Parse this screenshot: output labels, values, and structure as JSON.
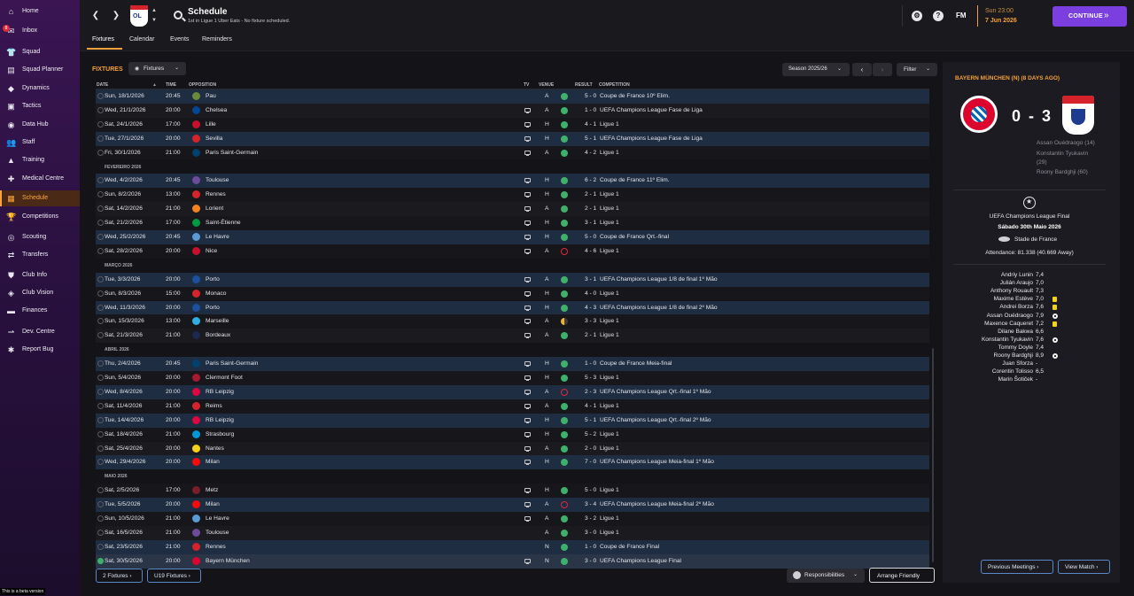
{
  "sidebar": {
    "items": [
      {
        "label": "Home",
        "icon": "home-icon",
        "glyph": "⌂"
      },
      {
        "label": "Inbox",
        "icon": "inbox-icon",
        "glyph": "✉",
        "badge": "8"
      },
      {
        "label": "Squad",
        "icon": "squad-icon",
        "glyph": "👕"
      },
      {
        "label": "Squad Planner",
        "icon": "planner-icon",
        "glyph": "▤"
      },
      {
        "label": "Dynamics",
        "icon": "dynamics-icon",
        "glyph": "◆"
      },
      {
        "label": "Tactics",
        "icon": "tactics-icon",
        "glyph": "▣"
      },
      {
        "label": "Data Hub",
        "icon": "data-hub-icon",
        "glyph": "◉"
      },
      {
        "label": "Staff",
        "icon": "staff-icon",
        "glyph": "👥"
      },
      {
        "label": "Training",
        "icon": "training-icon",
        "glyph": "▲"
      },
      {
        "label": "Medical Centre",
        "icon": "medical-icon",
        "glyph": "✚"
      },
      {
        "label": "Schedule",
        "icon": "schedule-icon",
        "glyph": "▦",
        "active": true
      },
      {
        "label": "Competitions",
        "icon": "trophy-icon",
        "glyph": "🏆"
      },
      {
        "label": "Scouting",
        "icon": "scouting-icon",
        "glyph": "◎"
      },
      {
        "label": "Transfers",
        "icon": "transfers-icon",
        "glyph": "⇄"
      },
      {
        "label": "Club Info",
        "icon": "club-info-icon",
        "glyph": "⛊"
      },
      {
        "label": "Club Vision",
        "icon": "club-vision-icon",
        "glyph": "◈"
      },
      {
        "label": "Finances",
        "icon": "finances-icon",
        "glyph": "▬"
      },
      {
        "label": "Dev. Centre",
        "icon": "dev-centre-icon",
        "glyph": "⇀"
      },
      {
        "label": "Report Bug",
        "icon": "bug-icon",
        "glyph": "✱"
      }
    ],
    "beta_text": "This is a beta version"
  },
  "topbar": {
    "title": "Schedule",
    "subtitle": "1st in Ligue 1 Uber Eats - No fixture scheduled.",
    "club_abbr": "OL",
    "date_time": "Sun 23:00",
    "date_day": "7 Jun 2026",
    "fm_label": "FM",
    "continue_label": "CONTINUE",
    "continue_icon": "»"
  },
  "tabs": [
    "Fixtures",
    "Calendar",
    "Events",
    "Reminders"
  ],
  "fixtures_panel": {
    "heading": "FIXTURES",
    "view_dropdown": "Fixtures",
    "season": "Season 2025/26",
    "filter": "Filter",
    "columns": {
      "date": "DATE",
      "time": "TIME",
      "opposition": "OPPOSITION",
      "tv": "TV",
      "venue": "VENUE",
      "result": "RESULT",
      "competition": "COMPETITION"
    },
    "footer_btn1": "2 Fixtures ›",
    "footer_btn2": "U19 Fixtures ›",
    "responsibilities": "Responsibilities",
    "arrange_friendly": "Arrange Friendly"
  },
  "fixtures": [
    {
      "date": "Sun, 18/1/2026",
      "time": "20:45",
      "opp": "Pau",
      "tv": false,
      "venue": "A",
      "res": "W",
      "score": "5 - 0",
      "comp": "Coupe de France 10º Elim.",
      "crest": "#6b8b3a",
      "bg": "blue"
    },
    {
      "date": "Wed, 21/1/2026",
      "time": "20:00",
      "opp": "Chelsea",
      "tv": true,
      "venue": "A",
      "res": "W",
      "score": "1 - 0",
      "comp": "UEFA Champions League Fase de Liga",
      "crest": "#034694",
      "bg": "dark"
    },
    {
      "date": "Sat, 24/1/2026",
      "time": "17:00",
      "opp": "Lille",
      "tv": true,
      "venue": "H",
      "res": "W",
      "score": "4 - 1",
      "comp": "Ligue 1",
      "crest": "#c8102e",
      "bg": "alt"
    },
    {
      "date": "Tue, 27/1/2026",
      "time": "20:00",
      "opp": "Sevilla",
      "tv": true,
      "venue": "H",
      "res": "W",
      "score": "5 - 1",
      "comp": "UEFA Champions League Fase de Liga",
      "crest": "#d6232b",
      "bg": "blue"
    },
    {
      "date": "Fri, 30/1/2026",
      "time": "21:00",
      "opp": "Paris Saint-Germain",
      "tv": true,
      "venue": "A",
      "res": "W",
      "score": "4 - 2",
      "comp": "Ligue 1",
      "crest": "#004170",
      "bg": "alt"
    },
    {
      "month": "FEVEREIRO 2026"
    },
    {
      "date": "Wed, 4/2/2026",
      "time": "20:45",
      "opp": "Toulouse",
      "tv": true,
      "venue": "H",
      "res": "W",
      "score": "6 - 2",
      "comp": "Coupe de France 11º Elim.",
      "crest": "#6c4a9c",
      "bg": "blue"
    },
    {
      "date": "Sun, 8/2/2026",
      "time": "13:00",
      "opp": "Rennes",
      "tv": true,
      "venue": "H",
      "res": "W",
      "score": "2 - 1",
      "comp": "Ligue 1",
      "crest": "#d6232b",
      "bg": "alt"
    },
    {
      "date": "Sat, 14/2/2026",
      "time": "21:00",
      "opp": "Lorient",
      "tv": true,
      "venue": "A",
      "res": "W",
      "score": "2 - 1",
      "comp": "Ligue 1",
      "crest": "#f58220",
      "bg": "dark"
    },
    {
      "date": "Sat, 21/2/2026",
      "time": "17:00",
      "opp": "Saint-Étienne",
      "tv": true,
      "venue": "H",
      "res": "W",
      "score": "3 - 1",
      "comp": "Ligue 1",
      "crest": "#009a44",
      "bg": "alt"
    },
    {
      "date": "Wed, 25/2/2026",
      "time": "20:45",
      "opp": "Le Havre",
      "tv": true,
      "venue": "H",
      "res": "W",
      "score": "5 - 0",
      "comp": "Coupe de France Qrt.-final",
      "crest": "#5b9bd5",
      "bg": "blue"
    },
    {
      "date": "Sat, 28/2/2026",
      "time": "20:00",
      "opp": "Nice",
      "tv": true,
      "venue": "A",
      "res": "L",
      "score": "4 - 6",
      "comp": "Ligue 1",
      "crest": "#c8102e",
      "bg": "alt"
    },
    {
      "month": "MARÇO 2026"
    },
    {
      "date": "Tue, 3/3/2026",
      "time": "20:00",
      "opp": "Porto",
      "tv": true,
      "venue": "A",
      "res": "W",
      "score": "3 - 1",
      "comp": "UEFA Champions League 1/8 de final 1º Mão",
      "crest": "#1c4f9c",
      "bg": "blue"
    },
    {
      "date": "Sun, 8/3/2026",
      "time": "15:00",
      "opp": "Monaco",
      "tv": true,
      "venue": "H",
      "res": "W",
      "score": "4 - 0",
      "comp": "Ligue 1",
      "crest": "#d6232b",
      "bg": "alt"
    },
    {
      "date": "Wed, 11/3/2026",
      "time": "20:00",
      "opp": "Porto",
      "tv": true,
      "venue": "H",
      "res": "W",
      "score": "4 - 3",
      "comp": "UEFA Champions League 1/8 de final 2º Mão",
      "crest": "#1c4f9c",
      "bg": "blue"
    },
    {
      "date": "Sun, 15/3/2026",
      "time": "13:00",
      "opp": "Marseille",
      "tv": true,
      "venue": "A",
      "res": "D",
      "score": "3 - 3",
      "comp": "Ligue 1",
      "crest": "#2faee0",
      "bg": "alt"
    },
    {
      "date": "Sat, 21/3/2026",
      "time": "21:00",
      "opp": "Bordeaux",
      "tv": true,
      "venue": "A",
      "res": "W",
      "score": "2 - 1",
      "comp": "Ligue 1",
      "crest": "#1b2a4e",
      "bg": "dark"
    },
    {
      "month": "ABRIL 2026"
    },
    {
      "date": "Thu, 2/4/2026",
      "time": "20:45",
      "opp": "Paris Saint-Germain",
      "tv": true,
      "venue": "H",
      "res": "W",
      "score": "1 - 0",
      "comp": "Coupe de France Meia-final",
      "crest": "#004170",
      "bg": "blue"
    },
    {
      "date": "Sun, 5/4/2026",
      "time": "20:00",
      "opp": "Clermont Foot",
      "tv": true,
      "venue": "H",
      "res": "W",
      "score": "5 - 3",
      "comp": "Ligue 1",
      "crest": "#a6192e",
      "bg": "alt"
    },
    {
      "date": "Wed, 8/4/2026",
      "time": "20:00",
      "opp": "RB Leipzig",
      "tv": true,
      "venue": "A",
      "res": "L",
      "score": "2 - 3",
      "comp": "UEFA Champions League Qrt.-final 1º Mão",
      "crest": "#dd0741",
      "bg": "blue"
    },
    {
      "date": "Sat, 11/4/2026",
      "time": "21:00",
      "opp": "Reims",
      "tv": true,
      "venue": "A",
      "res": "W",
      "score": "4 - 1",
      "comp": "Ligue 1",
      "crest": "#d6232b",
      "bg": "alt"
    },
    {
      "date": "Tue, 14/4/2026",
      "time": "20:00",
      "opp": "RB Leipzig",
      "tv": true,
      "venue": "H",
      "res": "W",
      "score": "5 - 1",
      "comp": "UEFA Champions League Qrt.-final 2º Mão",
      "crest": "#dd0741",
      "bg": "blue"
    },
    {
      "date": "Sat, 18/4/2026",
      "time": "21:00",
      "opp": "Strasbourg",
      "tv": true,
      "venue": "H",
      "res": "W",
      "score": "5 - 2",
      "comp": "Ligue 1",
      "crest": "#0097d6",
      "bg": "alt"
    },
    {
      "date": "Sat, 25/4/2026",
      "time": "20:00",
      "opp": "Nantes",
      "tv": true,
      "venue": "A",
      "res": "W",
      "score": "2 - 0",
      "comp": "Ligue 1",
      "crest": "#f7d117",
      "bg": "dark"
    },
    {
      "date": "Wed, 29/4/2026",
      "time": "20:00",
      "opp": "Milan",
      "tv": true,
      "venue": "H",
      "res": "W",
      "score": "7 - 0",
      "comp": "UEFA Champions League Meia-final 1º Mão",
      "crest": "#fb090b",
      "bg": "blue"
    },
    {
      "month": "MAIO 2026"
    },
    {
      "date": "Sat, 2/5/2026",
      "time": "17:00",
      "opp": "Metz",
      "tv": true,
      "venue": "H",
      "res": "W",
      "score": "5 - 0",
      "comp": "Ligue 1",
      "crest": "#7a1e2c",
      "bg": "alt"
    },
    {
      "date": "Tue, 5/5/2026",
      "time": "20:00",
      "opp": "Milan",
      "tv": true,
      "venue": "A",
      "res": "L",
      "score": "3 - 4",
      "comp": "UEFA Champions League Meia-final 2º Mão",
      "crest": "#fb090b",
      "bg": "blue"
    },
    {
      "date": "Sun, 10/5/2026",
      "time": "21:00",
      "opp": "Le Havre",
      "tv": true,
      "venue": "A",
      "res": "W",
      "score": "3 - 2",
      "comp": "Ligue 1",
      "crest": "#5b9bd5",
      "bg": "alt"
    },
    {
      "date": "Sat, 16/5/2026",
      "time": "21:00",
      "opp": "Toulouse",
      "tv": false,
      "venue": "A",
      "res": "W",
      "score": "3 - 0",
      "comp": "Ligue 1",
      "crest": "#6c4a9c",
      "bg": "dark"
    },
    {
      "date": "Sat, 23/5/2026",
      "time": "21:00",
      "opp": "Rennes",
      "tv": false,
      "venue": "N",
      "res": "W",
      "score": "1 - 0",
      "comp": "Coupe de France Final",
      "crest": "#d6232b",
      "bg": "blue"
    },
    {
      "date": "Sat, 30/5/2026",
      "time": "20:00",
      "opp": "Bayern München",
      "tv": true,
      "venue": "N",
      "res": "W",
      "score": "3 - 0",
      "comp": "UEFA Champions League Final",
      "crest": "#dc052d",
      "bg": "hl",
      "selected": true
    }
  ],
  "match_panel": {
    "title": "BAYERN MÜNCHEN (N) (8 DAYS AGO)",
    "score": "0 - 3",
    "scorers": [
      "Assan Ouédraogo (14)",
      "Konstantin Tyukavin",
      "(29)",
      "Roony Bardghji (60)"
    ],
    "competition": "UEFA Champions League Final",
    "match_date": "Sábado 30th Maio 2026",
    "stadium": "Stade de France",
    "attendance": "Attendance: 81.338 (40.669 Away)",
    "players": [
      {
        "name": "Andriy Lunin",
        "rating": "7,4",
        "icon": ""
      },
      {
        "name": "Julián Araujo",
        "rating": "7,0",
        "icon": ""
      },
      {
        "name": "Anthony Rouault",
        "rating": "7,3",
        "icon": ""
      },
      {
        "name": "Maxime Estève",
        "rating": "7,0",
        "icon": "card"
      },
      {
        "name": "Andrei Borza",
        "rating": "7,6",
        "icon": "card"
      },
      {
        "name": "Assan Ouédraogo",
        "rating": "7,9",
        "icon": "ball"
      },
      {
        "name": "Maxence Caqueret",
        "rating": "7,2",
        "icon": "card"
      },
      {
        "name": "Dilane Bakwa",
        "rating": "6,6",
        "icon": ""
      },
      {
        "name": "Konstantin Tyukavin",
        "rating": "7,6",
        "icon": "ball"
      },
      {
        "name": "Tommy Doyle",
        "rating": "7,4",
        "icon": ""
      },
      {
        "name": "Roony Bardghji",
        "rating": "8,9",
        "icon": "ball"
      },
      {
        "name": "Juan Sforza",
        "rating": "-",
        "icon": ""
      },
      {
        "name": "Corentin Tolisso",
        "rating": "6,5",
        "icon": ""
      },
      {
        "name": "Marin Šotiček",
        "rating": "-",
        "icon": ""
      }
    ],
    "prev_meetings": "Previous Meetings ›",
    "view_match": "View Match ›"
  }
}
